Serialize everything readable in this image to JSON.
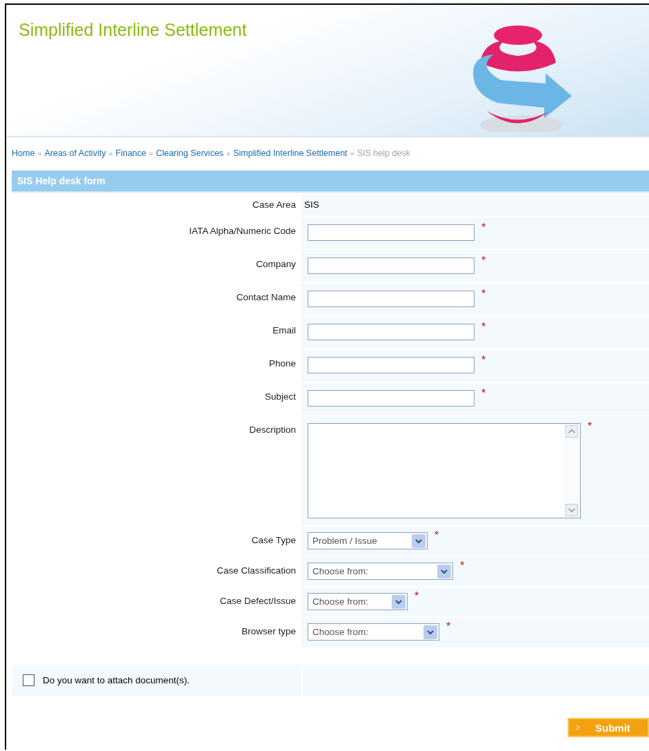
{
  "header": {
    "title": "Simplified Interline Settlement"
  },
  "breadcrumb": {
    "separator": "»",
    "items": [
      {
        "label": "Home",
        "current": false
      },
      {
        "label": "Areas of Activity",
        "current": false
      },
      {
        "label": "Finance",
        "current": false
      },
      {
        "label": "Clearing Services",
        "current": false
      },
      {
        "label": "Simplified Interline Settlement",
        "current": false
      },
      {
        "label": "SIS help desk",
        "current": true
      }
    ]
  },
  "form": {
    "title": "SIS Help desk form",
    "required_mark": "*",
    "fields": [
      {
        "kind": "static",
        "label": "Case Area",
        "value": "SIS",
        "required": false
      },
      {
        "kind": "text",
        "label": "IATA Alpha/Numeric Code",
        "required": true
      },
      {
        "kind": "text",
        "label": "Company",
        "required": true
      },
      {
        "kind": "text",
        "label": "Contact Name",
        "required": true
      },
      {
        "kind": "text",
        "label": "Email",
        "required": true
      },
      {
        "kind": "text",
        "label": "Phone",
        "required": true
      },
      {
        "kind": "text",
        "label": "Subject",
        "required": true
      },
      {
        "kind": "textarea",
        "label": "Description",
        "required": true
      },
      {
        "kind": "select",
        "label": "Case Type",
        "value": "Problem / Issue",
        "required": true
      },
      {
        "kind": "select",
        "label": "Case Classification",
        "value": "Choose from:",
        "required": true
      },
      {
        "kind": "select",
        "label": "Case Defect/Issue",
        "value": "Choose from:",
        "required": true
      },
      {
        "kind": "select",
        "label": "Browser type",
        "value": "Choose from:",
        "required": true
      }
    ],
    "attach": {
      "label": "Do you want to attach document(s).",
      "checked": false
    },
    "submit": "Submit"
  }
}
